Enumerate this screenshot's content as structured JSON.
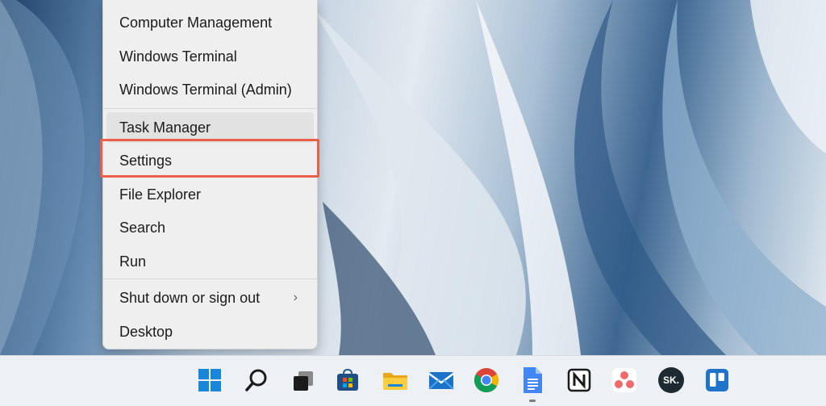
{
  "context_menu": {
    "items": [
      {
        "label": "Computer Management"
      },
      {
        "label": "Windows Terminal"
      },
      {
        "label": "Windows Terminal (Admin)"
      },
      {
        "label": "Task Manager"
      },
      {
        "label": "Settings"
      },
      {
        "label": "File Explorer"
      },
      {
        "label": "Search"
      },
      {
        "label": "Run"
      },
      {
        "label": "Shut down or sign out",
        "submenu_glyph": "›"
      },
      {
        "label": "Desktop"
      }
    ],
    "highlighted_item": "Settings",
    "highlight_color": "#e8604a"
  },
  "taskbar": {
    "icons": [
      {
        "name": "windows-start-icon"
      },
      {
        "name": "search-icon"
      },
      {
        "name": "task-view-icon"
      },
      {
        "name": "microsoft-store-icon"
      },
      {
        "name": "file-explorer-icon"
      },
      {
        "name": "mail-icon"
      },
      {
        "name": "chrome-icon"
      },
      {
        "name": "google-docs-icon"
      },
      {
        "name": "notion-icon"
      },
      {
        "name": "asana-icon"
      },
      {
        "name": "sk-app-icon",
        "text": "SK."
      },
      {
        "name": "trello-icon"
      }
    ]
  }
}
